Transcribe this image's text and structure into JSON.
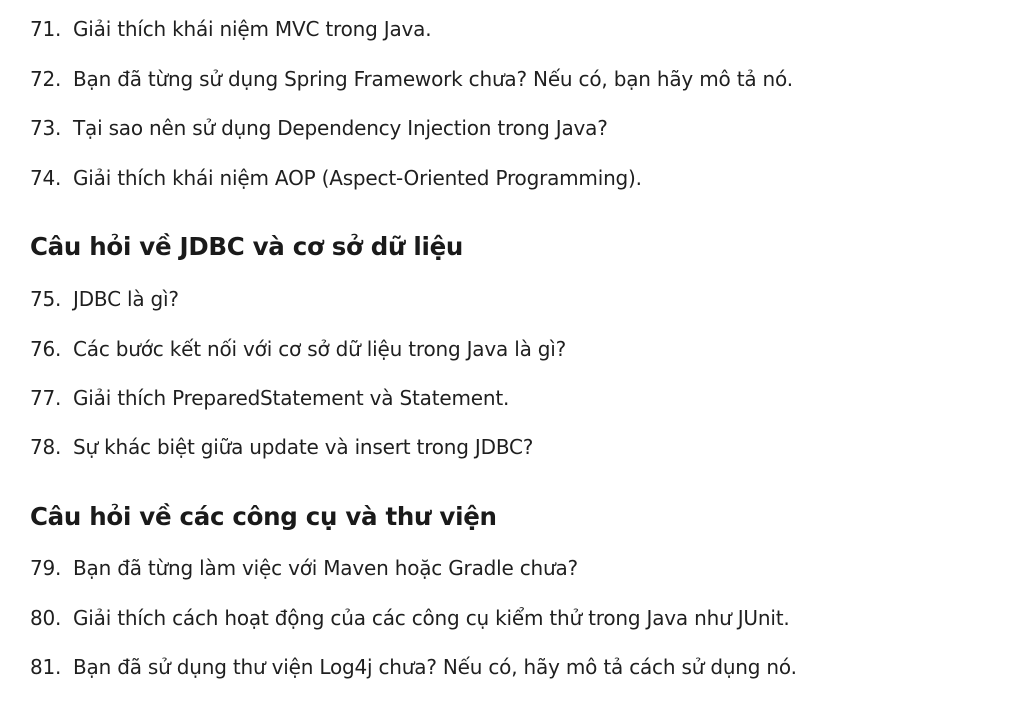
{
  "list1": [
    {
      "num": "71.",
      "text": "Giải thích khái niệm MVC trong Java."
    },
    {
      "num": "72.",
      "text": "Bạn đã từng sử dụng Spring Framework chưa? Nếu có, bạn hãy mô tả nó."
    },
    {
      "num": "73.",
      "text": "Tại sao nên sử dụng Dependency Injection trong Java?"
    },
    {
      "num": "74.",
      "text": "Giải thích khái niệm AOP (Aspect-Oriented Programming)."
    }
  ],
  "heading1": "Câu hỏi về JDBC và cơ sở dữ liệu",
  "list2": [
    {
      "num": "75.",
      "text": "JDBC là gì?"
    },
    {
      "num": "76.",
      "text": "Các bước kết nối với cơ sở dữ liệu trong Java là gì?"
    },
    {
      "num": "77.",
      "text": "Giải thích PreparedStatement và Statement."
    },
    {
      "num": "78.",
      "text": "Sự khác biệt giữa update và insert trong JDBC?"
    }
  ],
  "heading2": "Câu hỏi về các công cụ và thư viện",
  "list3": [
    {
      "num": "79.",
      "text": "Bạn đã từng làm việc với Maven hoặc Gradle chưa?"
    },
    {
      "num": "80.",
      "text": "Giải thích cách hoạt động của các công cụ kiểm thử trong Java như JUnit."
    },
    {
      "num": "81.",
      "text": "Bạn đã sử dụng thư viện Log4j chưa? Nếu có, hãy mô tả cách sử dụng nó."
    }
  ]
}
